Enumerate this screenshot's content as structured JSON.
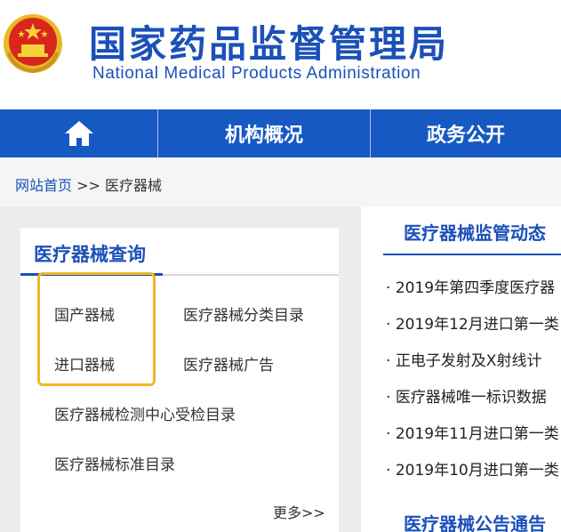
{
  "header": {
    "title_cn": "国家药品监督管理局",
    "title_en": "National Medical Products Administration",
    "emblem_icon": "national-emblem-icon"
  },
  "nav": {
    "home_icon": "home-icon",
    "items": [
      {
        "label": "机构概况"
      },
      {
        "label": "政务公开"
      }
    ]
  },
  "breadcrumb": {
    "home": "网站首页",
    "separator": ">>",
    "current": "医疗器械"
  },
  "query_panel": {
    "title": "医疗器械查询",
    "links": {
      "domestic": "国产器械",
      "catalog": "医疗器械分类目录",
      "imported": "进口器械",
      "ads": "医疗器械广告",
      "testing": "医疗器械检测中心受检目录",
      "standards": "医疗器械标准目录"
    },
    "more": "更多>>"
  },
  "news_panel": {
    "title": "医疗器械监管动态",
    "items": [
      "2019年第四季度医疗器",
      "2019年12月进口第一类",
      "正电子发射及X射线计",
      "医疗器械唯一标识数据",
      "2019年11月进口第一类",
      "2019年10月进口第一类"
    ],
    "bullet": "·",
    "title2": "医疗器械公告通告"
  },
  "colors": {
    "brand_blue": "#1659c2",
    "title_blue": "#1a50b8",
    "highlight": "#f2b824"
  }
}
